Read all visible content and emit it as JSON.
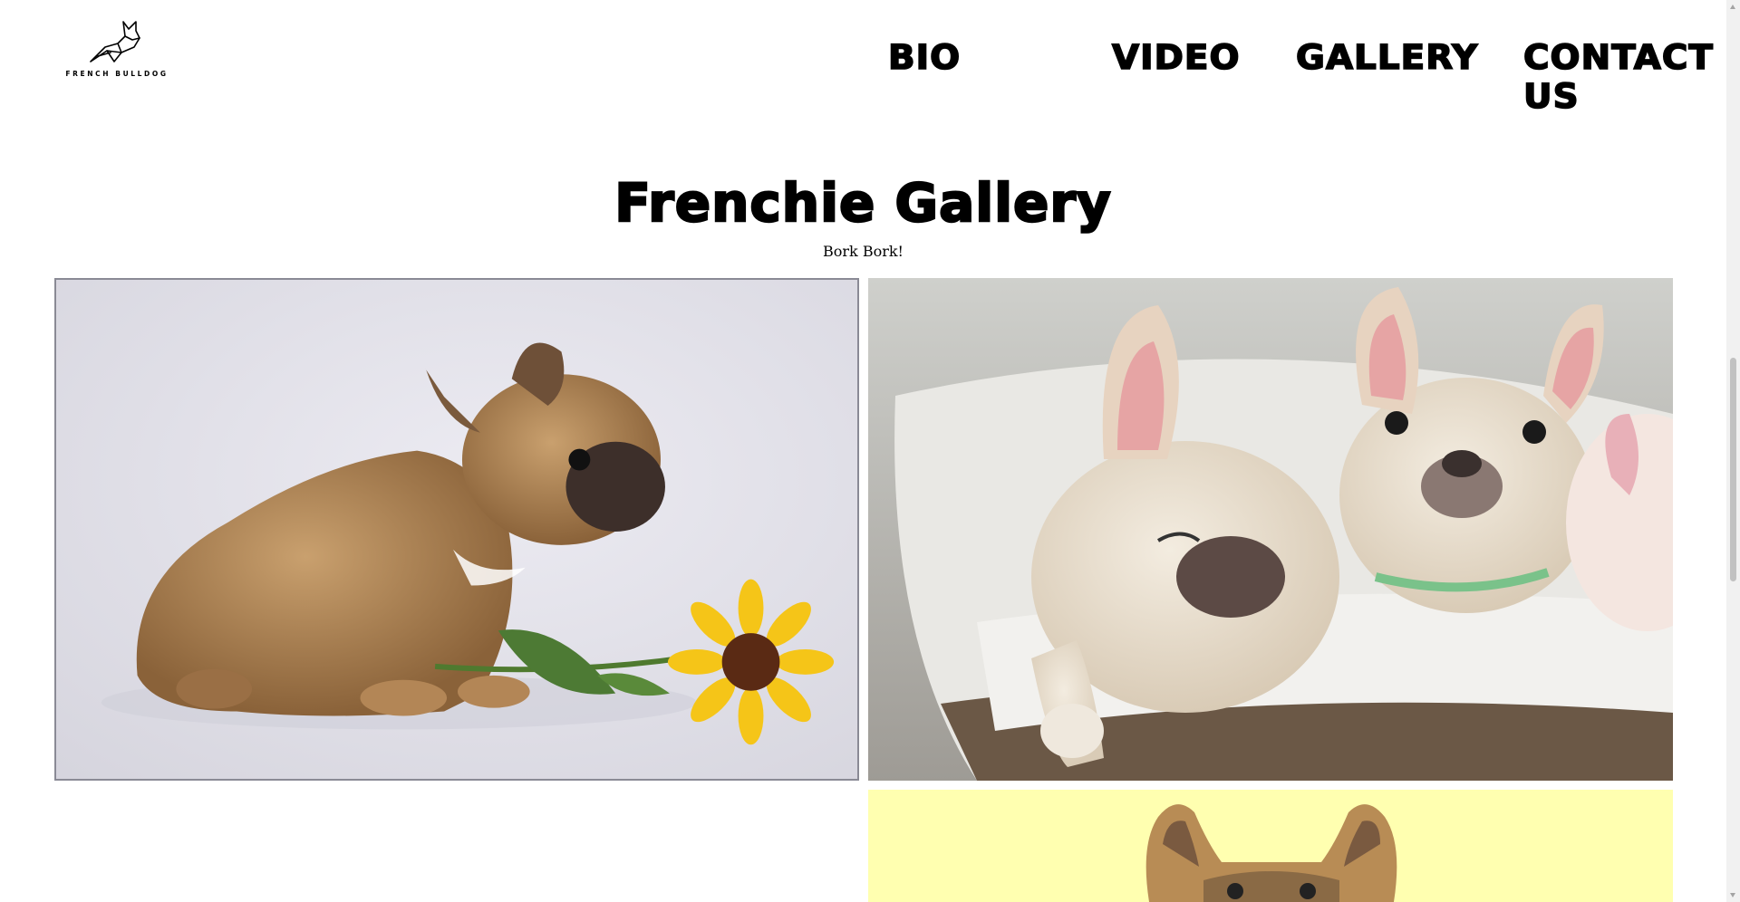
{
  "header": {
    "logo_text": "FRENCH BULLDOG",
    "logo_icon": "dog-line-icon",
    "nav": [
      {
        "label": "BIO"
      },
      {
        "label": "VIDEO"
      },
      {
        "label": "GALLERY"
      },
      {
        "label": "CONTACT US"
      }
    ]
  },
  "main": {
    "title": "Frenchie Gallery",
    "subtitle": "Bork Bork!"
  },
  "gallery": {
    "photos": [
      {
        "name": "brown puppy with sunflower"
      },
      {
        "name": "cream puppies in basket"
      },
      {
        "name": "fawn frenchie on yellow"
      }
    ]
  },
  "colors": {
    "text": "#000000",
    "background": "#ffffff",
    "photo3_bg": "#ffffb0"
  }
}
